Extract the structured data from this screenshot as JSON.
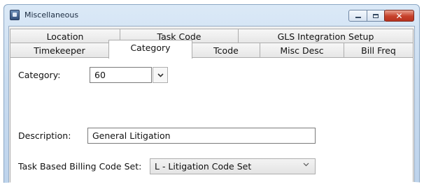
{
  "window": {
    "title": "Miscellaneous",
    "icon": "app-window-icon",
    "controls": {
      "minimize": "minimize-icon",
      "maximize": "maximize-icon",
      "close": "close-icon"
    }
  },
  "tabs": {
    "row1": [
      "Location",
      "Task Code",
      "GLS Integration Setup"
    ],
    "row2": [
      "Timekeeper",
      "Category",
      "Tcode",
      "Misc Desc",
      "Bill Freq"
    ],
    "active": "Category"
  },
  "form": {
    "category_label": "Category:",
    "category_value": "60",
    "description_label": "Description:",
    "description_value": "General Litigation",
    "task_billing_label": "Task Based Billing Code Set:",
    "task_billing_value": "L - Litigation Code Set"
  },
  "colors": {
    "title_bar": "#c9dcf0",
    "close_button": "#c6402a",
    "page_background": "#ffffff",
    "dialog_background": "#f0f0f0"
  }
}
